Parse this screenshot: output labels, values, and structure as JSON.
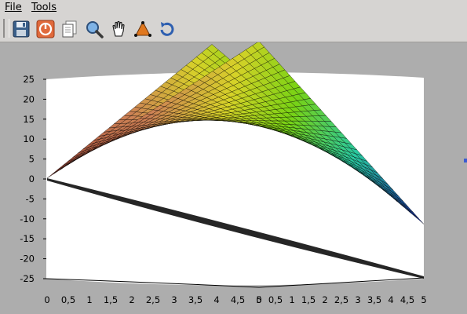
{
  "menu": {
    "file": "File",
    "tools": "Tools"
  },
  "toolbar": {
    "buttons": [
      {
        "icon": "save-icon"
      },
      {
        "icon": "stop-icon"
      },
      {
        "icon": "copy-icon"
      },
      {
        "icon": "zoom-icon"
      },
      {
        "icon": "pan-hand-icon"
      },
      {
        "icon": "datatip-cone-icon"
      },
      {
        "icon": "rotate-icon"
      }
    ]
  },
  "colors": {
    "window_bg": "#adadad",
    "toolbar_bg": "#d6d4d2",
    "plot_bg": "#ffffff",
    "mesh_line": "#000000"
  },
  "chart_data": {
    "type": "surface3d",
    "title": "",
    "xlabel": "",
    "ylabel": "",
    "zlabel": "",
    "grid": false,
    "legend": "none",
    "colormap": "jet-like (red low, yellow/green mid, cyan/blue high)",
    "x": [
      0,
      5
    ],
    "y": [
      0,
      5
    ],
    "zlim": [
      -25,
      25
    ],
    "z_ticks": [
      "25",
      "20",
      "15",
      "10",
      "5",
      "0",
      "-5",
      "-10",
      "-15",
      "-20",
      "-25"
    ],
    "x_ticks": [
      "0",
      "0,5",
      "1",
      "1,5",
      "2",
      "2,5",
      "3",
      "3,5",
      "4",
      "4,5",
      "5"
    ],
    "y_ticks": [
      "0",
      "0,5",
      "1",
      "1,5",
      "2",
      "2,5",
      "3",
      "3,5",
      "4",
      "4,5",
      "5"
    ],
    "corners": [
      {
        "x": 0,
        "y": 0,
        "z": 0
      },
      {
        "x": 5,
        "y": 0,
        "z": 25
      },
      {
        "x": 0,
        "y": 5,
        "z": 25
      },
      {
        "x": 5,
        "y": 5,
        "z": -25
      }
    ]
  }
}
